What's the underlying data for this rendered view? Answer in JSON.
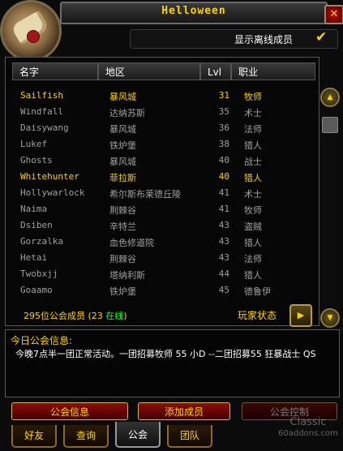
{
  "window": {
    "title": "Helloween",
    "close_label": "✕"
  },
  "portrait": {
    "icon": "guild-scroll-icon"
  },
  "offline": {
    "label": "显示离线成员",
    "checked": true,
    "check_glyph": "✔"
  },
  "columns": {
    "name": "名字",
    "zone": "地区",
    "level": "Lvl",
    "class": "职业"
  },
  "members": [
    {
      "name": "Sailfish",
      "zone": "暴风城",
      "level": "31",
      "class": "牧师",
      "color": "#ffd100"
    },
    {
      "name": "Windfall",
      "zone": "达纳苏斯",
      "level": "35",
      "class": "术士",
      "color": "#a0a0a0"
    },
    {
      "name": "Daisywang",
      "zone": "暴风城",
      "level": "36",
      "class": "法师",
      "color": "#a0a0a0"
    },
    {
      "name": "Lukef",
      "zone": "铁炉堡",
      "level": "38",
      "class": "猎人",
      "color": "#a0a0a0"
    },
    {
      "name": "Ghosts",
      "zone": "暴风城",
      "level": "40",
      "class": "战士",
      "color": "#a0a0a0"
    },
    {
      "name": "Whitehunter",
      "zone": "菲拉斯",
      "level": "40",
      "class": "猎人",
      "color": "#ffd100"
    },
    {
      "name": "Hollywarlock",
      "zone": "希尔斯布莱德丘陵",
      "level": "41",
      "class": "术士",
      "color": "#a0a0a0"
    },
    {
      "name": "Naima",
      "zone": "荆棘谷",
      "level": "41",
      "class": "牧师",
      "color": "#a0a0a0"
    },
    {
      "name": "Dsiben",
      "zone": "辛特兰",
      "level": "43",
      "class": "盗贼",
      "color": "#a0a0a0"
    },
    {
      "name": "Gorzalka",
      "zone": "血色修道院",
      "level": "43",
      "class": "猎人",
      "color": "#a0a0a0"
    },
    {
      "name": "Hetai",
      "zone": "荆棘谷",
      "level": "43",
      "class": "法师",
      "color": "#a0a0a0"
    },
    {
      "name": "Twobxjj",
      "zone": "塔纳利斯",
      "level": "44",
      "class": "猎人",
      "color": "#a0a0a0"
    },
    {
      "name": "Goaamo",
      "zone": "铁炉堡",
      "level": "45",
      "class": "德鲁伊",
      "color": "#a0a0a0"
    }
  ],
  "summary": {
    "count_text": "295位公会成员 (23 ",
    "online_text": "在线",
    "close_paren": ")"
  },
  "player_status": {
    "label": "玩家状态",
    "arrow": "▶"
  },
  "scroll": {
    "up": "▲",
    "down": "▼"
  },
  "motd": {
    "title": "今日公会信息:",
    "text": "今晚7点半一团正常活动。一团招募牧师 55 小D --二团招募55 狂暴战士 QS"
  },
  "buttons": {
    "guild_info": "公会信息",
    "add_member": "添加成员",
    "guild_control": "公会控制"
  },
  "tabs": [
    {
      "label": "好友"
    },
    {
      "label": "查询"
    },
    {
      "label": "公会"
    },
    {
      "label": "团队"
    }
  ],
  "watermark": {
    "line1": "Classic",
    "line2": "60addons.com"
  }
}
